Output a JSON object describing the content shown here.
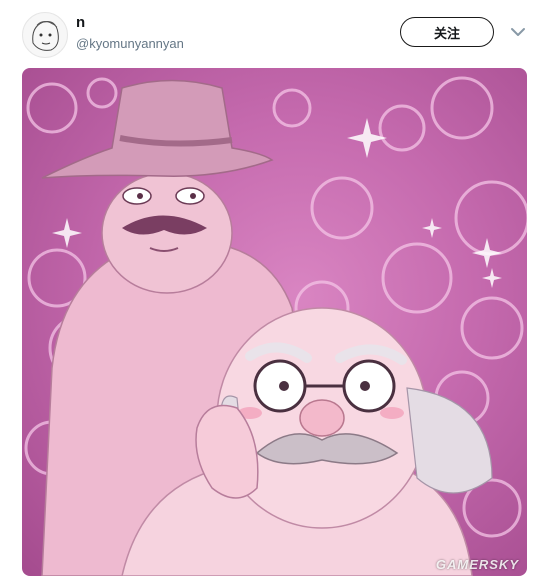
{
  "tweet": {
    "display_name": "n",
    "handle": "@kyomunyannyan",
    "follow_label": "关注"
  },
  "media": {
    "watermark": "GAMERSKY"
  },
  "colors": {
    "background_pink": "#c56aae",
    "skin": "#f2c9d8",
    "hat": "#d49ab8"
  },
  "icons": [
    "avatar-sketch",
    "chevron-down-icon"
  ]
}
